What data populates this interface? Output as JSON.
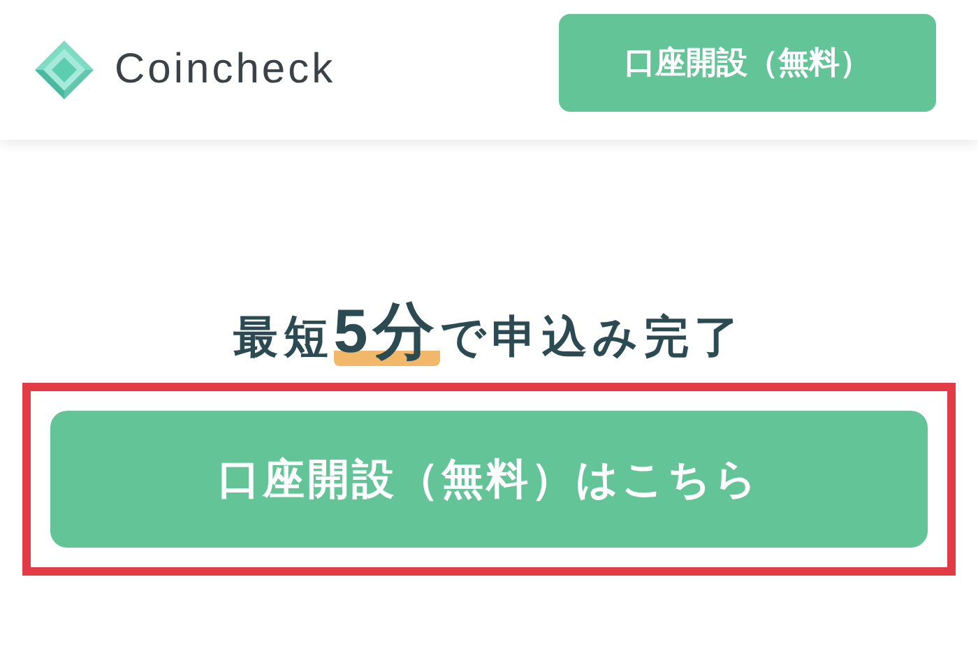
{
  "header": {
    "brand": "Coincheck",
    "button": "口座開設（無料）"
  },
  "headline": "最短**5分**で申込み完了",
  "cta": {
    "label": "口座開設（無料）はこちら",
    "highlighted": true
  }
}
